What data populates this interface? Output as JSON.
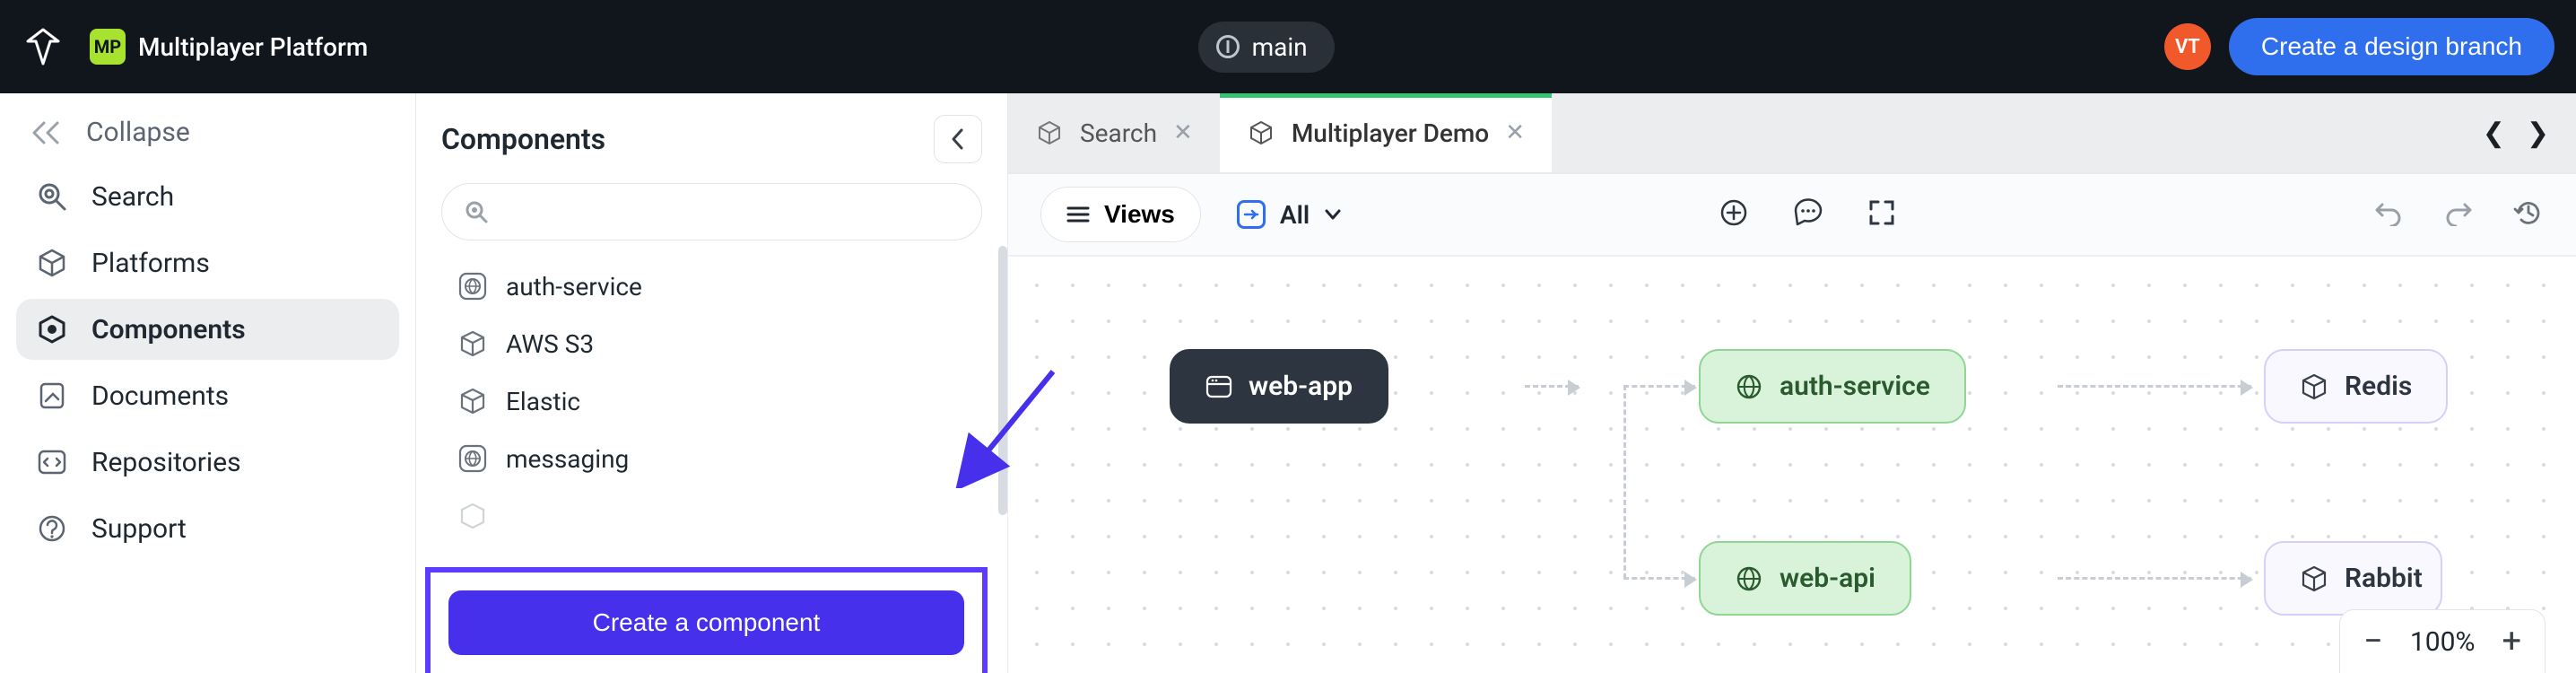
{
  "topbar": {
    "project_badge": "MP",
    "project_name": "Multiplayer Platform",
    "branch": "main",
    "avatar": "VT",
    "create_branch": "Create a design branch"
  },
  "rail": {
    "collapse": "Collapse",
    "items": [
      {
        "label": "Search"
      },
      {
        "label": "Platforms"
      },
      {
        "label": "Components"
      },
      {
        "label": "Documents"
      },
      {
        "label": "Repositories"
      },
      {
        "label": "Support"
      }
    ]
  },
  "panel": {
    "title": "Components",
    "search_placeholder": "",
    "items": [
      {
        "label": "auth-service",
        "icon": "globe"
      },
      {
        "label": "AWS S3",
        "icon": "cube"
      },
      {
        "label": "Elastic",
        "icon": "cube"
      },
      {
        "label": "messaging",
        "icon": "globe"
      }
    ],
    "create_label": "Create a component"
  },
  "tabs": [
    {
      "label": "Search",
      "active": false
    },
    {
      "label": "Multiplayer Demo",
      "active": true
    }
  ],
  "toolbar": {
    "views": "Views",
    "filter": "All"
  },
  "nodes": {
    "webapp": "web-app",
    "auth": "auth-service",
    "redis": "Redis",
    "webapi": "web-api",
    "rabbit": "Rabbit"
  },
  "zoom": {
    "level": "100%"
  }
}
